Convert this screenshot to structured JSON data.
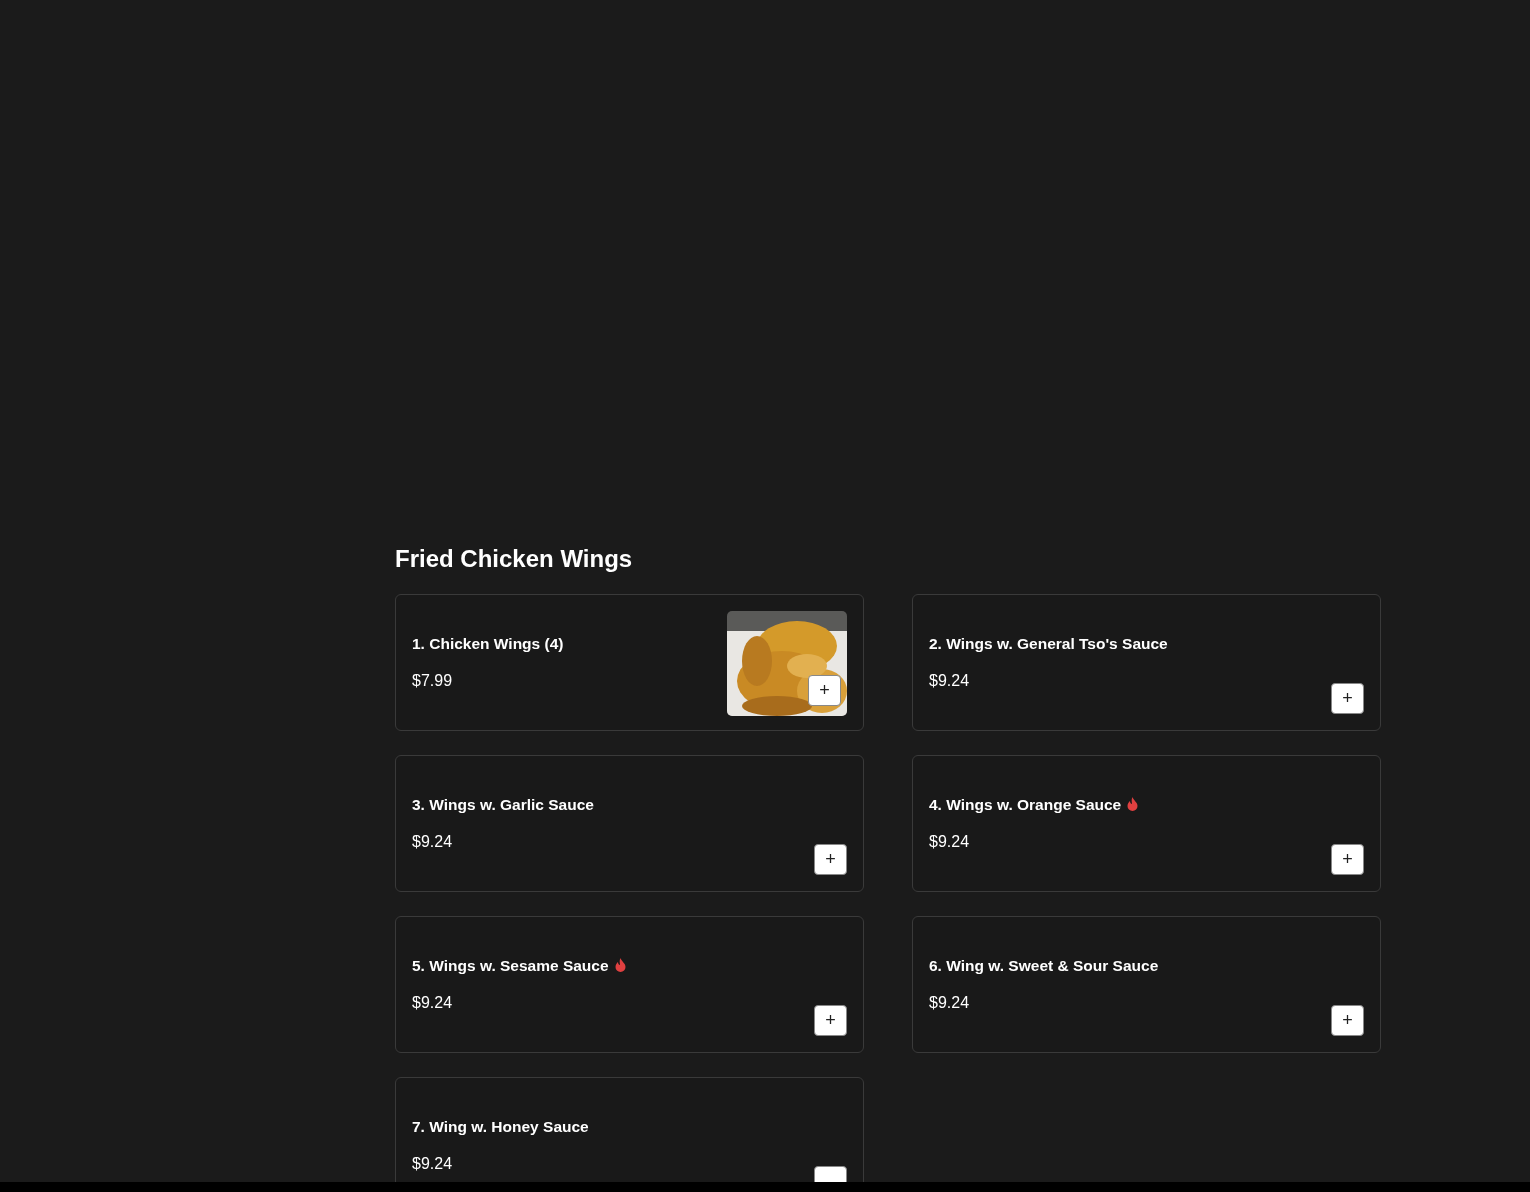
{
  "section": {
    "title": "Fried Chicken Wings"
  },
  "items": [
    {
      "name": "1. Chicken Wings (4)",
      "price": "$7.99",
      "spicy": false,
      "add": "+"
    },
    {
      "name": "2. Wings w. General Tso's Sauce",
      "price": "$9.24",
      "spicy": false,
      "add": "+"
    },
    {
      "name": "3. Wings w. Garlic Sauce",
      "price": "$9.24",
      "spicy": false,
      "add": "+"
    },
    {
      "name": "4. Wings w. Orange Sauce",
      "price": "$9.24",
      "spicy": true,
      "add": "+"
    },
    {
      "name": "5. Wings w. Sesame Sauce",
      "price": "$9.24",
      "spicy": true,
      "add": "+"
    },
    {
      "name": "6. Wing w. Sweet & Sour Sauce",
      "price": "$9.24",
      "spicy": false,
      "add": "+"
    },
    {
      "name": "7. Wing w. Honey Sauce",
      "price": "$9.24",
      "spicy": false
    }
  ]
}
